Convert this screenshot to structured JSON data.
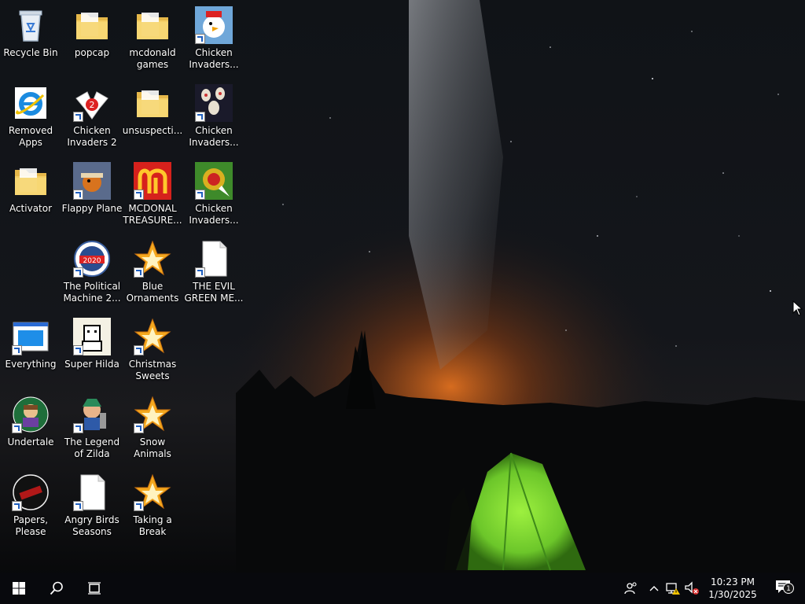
{
  "desktop": {
    "icons": [
      {
        "label": "Recycle Bin",
        "icon": "recycle-bin-icon",
        "shortcut": false
      },
      {
        "label": "popcap",
        "icon": "folder-icon",
        "shortcut": false
      },
      {
        "label": "mcdonald games",
        "icon": "folder-icon",
        "shortcut": false
      },
      {
        "label": "Chicken Invaders...",
        "icon": "chicken-icon",
        "shortcut": true
      },
      {
        "label": "Removed Apps",
        "icon": "internet-explorer-icon",
        "shortcut": false
      },
      {
        "label": "Chicken Invaders 2",
        "icon": "chicken-invaders-2-icon",
        "shortcut": true
      },
      {
        "label": "unsuspecti...",
        "icon": "folder-icon",
        "shortcut": false
      },
      {
        "label": "Chicken Invaders...",
        "icon": "chicken-invaders-eggs-icon",
        "shortcut": true
      },
      {
        "label": "Activator",
        "icon": "folder-icon",
        "shortcut": false
      },
      {
        "label": "Flappy Plane",
        "icon": "flappy-plane-icon",
        "shortcut": true
      },
      {
        "label": "MCDONAL TREASURE...",
        "icon": "mcdonalds-icon",
        "shortcut": true
      },
      {
        "label": "Chicken Invaders...",
        "icon": "chicken-invaders-4-icon",
        "shortcut": true
      },
      {
        "label": "The Political Machine 2...",
        "icon": "political-machine-2020-icon",
        "shortcut": true
      },
      {
        "label": "Blue Ornaments",
        "icon": "popcap-game-icon",
        "shortcut": true
      },
      {
        "label": "THE EVIL GREEN ME...",
        "icon": "blank-file-icon",
        "shortcut": true
      },
      {
        "label": "Everything",
        "icon": "everything-search-icon",
        "shortcut": true
      },
      {
        "label": "Super Hilda",
        "icon": "super-hilda-icon",
        "shortcut": true
      },
      {
        "label": "Christmas Sweets",
        "icon": "popcap-game-icon",
        "shortcut": true
      },
      {
        "label": "Undertale",
        "icon": "undertale-icon",
        "shortcut": true
      },
      {
        "label": "The Legend of Zilda",
        "icon": "legend-of-zilda-icon",
        "shortcut": true
      },
      {
        "label": "Snow Animals",
        "icon": "popcap-game-icon",
        "shortcut": true
      },
      {
        "label": "Papers, Please",
        "icon": "papers-please-icon",
        "shortcut": true
      },
      {
        "label": "Angry Birds Seasons",
        "icon": "blank-file-icon",
        "shortcut": true
      },
      {
        "label": "Taking a Break",
        "icon": "popcap-game-icon",
        "shortcut": true
      }
    ]
  },
  "taskbar": {
    "start_icon": "windows-logo-icon",
    "search_icon": "search-icon",
    "task_view_icon": "task-view-icon",
    "tray": {
      "people_icon": "people-icon",
      "chevron_icon": "chevron-up-icon",
      "network_icon": "network-warning-icon",
      "volume_icon": "volume-muted-icon",
      "time": "10:23 PM",
      "date": "1/30/2025",
      "notifications_icon": "action-center-icon",
      "notification_count": "1"
    }
  },
  "colors": {
    "tent": "#7bd43a",
    "horizon_glow": "#e06a1e",
    "taskbar": "#0a0c10"
  }
}
